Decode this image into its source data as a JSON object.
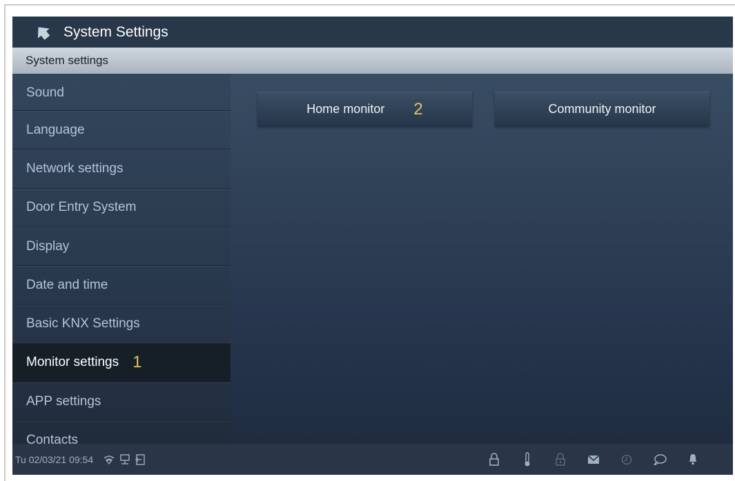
{
  "header": {
    "title": "System Settings"
  },
  "section": {
    "title": "System settings"
  },
  "sidebar": {
    "items": [
      {
        "label": "Sound"
      },
      {
        "label": "Language"
      },
      {
        "label": "Network settings"
      },
      {
        "label": "Door Entry System"
      },
      {
        "label": "Display"
      },
      {
        "label": "Date and time"
      },
      {
        "label": "Basic KNX Settings"
      },
      {
        "label": "Monitor settings",
        "marker": "1",
        "selected": true
      },
      {
        "label": "APP settings"
      },
      {
        "label": "Contacts"
      }
    ]
  },
  "main": {
    "buttons": [
      {
        "label": "Home monitor",
        "marker": "2"
      },
      {
        "label": "Community monitor"
      }
    ]
  },
  "status": {
    "datetime": "Tu 02/03/21  09:54",
    "left_icons": [
      "wifi-icon",
      "network-icon",
      "exit-icon"
    ],
    "right_icons": [
      "lock-icon",
      "thermometer-icon",
      "lock-alt-icon",
      "mail-icon",
      "history-icon",
      "chat-icon",
      "bell-icon"
    ]
  },
  "colors": {
    "marker": "#e3c45e",
    "background": "#2f4157",
    "selected_item": "#161e28"
  }
}
